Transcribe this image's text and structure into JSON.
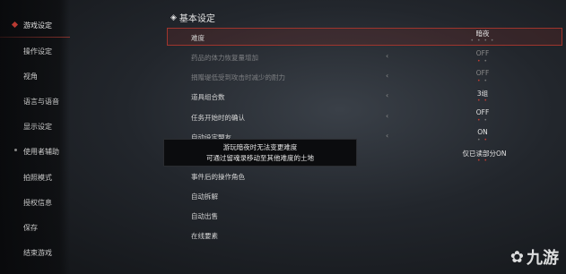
{
  "sidebar": {
    "items": [
      {
        "label": "游戏设定",
        "active": true
      },
      {
        "label": "操作设定"
      },
      {
        "label": "视角"
      },
      {
        "label": "语言与语音"
      },
      {
        "label": "显示设定"
      },
      {
        "label": "使用者辅助"
      },
      {
        "label": "拍照模式"
      },
      {
        "label": "授权信息"
      },
      {
        "label": "保存"
      },
      {
        "label": "结束游戏"
      }
    ]
  },
  "header": {
    "title": "基本设定",
    "icon": "diamond-icon"
  },
  "settings": [
    {
      "label": "难度",
      "value": "暗夜",
      "selected": true
    },
    {
      "label": "药品的体力恢复量增加",
      "value": "OFF",
      "dim": true
    },
    {
      "label": "捐赠堤低受到攻击时减少的耐力",
      "value": "OFF",
      "dim": true
    },
    {
      "label": "道具组合数",
      "value": "3组"
    },
    {
      "label": "任务开始时的确认",
      "value": "OFF"
    },
    {
      "label": "自动设定盟友",
      "value": "ON"
    },
    {
      "label": "",
      "value": "仅已读部分ON"
    },
    {
      "label": "事件后的操作角色",
      "value": ""
    },
    {
      "label": "自动拆解",
      "value": ""
    },
    {
      "label": "自动出售",
      "value": ""
    },
    {
      "label": "在线要素",
      "value": ""
    }
  ],
  "tooltip": {
    "line1": "游玩暗夜时无法变更难度",
    "line2": "可通过留魂录移动至其他难度的土地"
  },
  "watermark": {
    "text": "九游",
    "icon": "jiuyou-logo-icon"
  },
  "colors": {
    "accent": "#b93a32",
    "selection_border": "#a0352d"
  }
}
